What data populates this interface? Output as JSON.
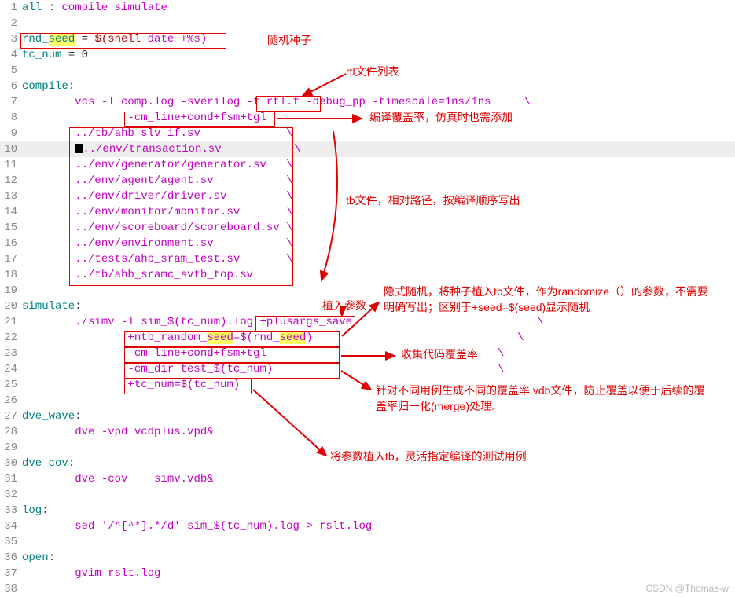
{
  "watermark": "CSDN @Thomas-w",
  "lines": {
    "l1_all": "all",
    "l1_sep": " : ",
    "l1_rest": "compile simulate",
    "l3_rnd": "rnd_",
    "l3_seed": "seed",
    "l3_eq": " = ",
    "l3_shell": "$(shell",
    "l3_date": " date +%s)",
    "l4_tcnum": "tc_num",
    "l4_rest": " = 0",
    "l6_compile": "compile",
    "l6_colon": ":",
    "l7_indent": "        ",
    "l7_vcs": "vcs -l comp.log -sverilog -f rtl.f -debug_pp -timescale=1ns/1ns     \\",
    "l8_indent": "                ",
    "l8_cm": "-cm_line+cond+fsm+tgl",
    "l8_bs": "                       \\",
    "l9_indent": "        ",
    "l9_txt": "../tb/ahb_slv_if.sv",
    "l9_bs": "             \\",
    "l10_indent": "        ",
    "l10_txt": "../env/transaction.sv",
    "l10_bs": "           \\",
    "l11_indent": "        ",
    "l11_txt": "../env/generator/generator.sv",
    "l11_bs": "   \\",
    "l12_indent": "        ",
    "l12_txt": "../env/agent/agent.sv",
    "l12_bs": "           \\",
    "l13_indent": "        ",
    "l13_txt": "../env/driver/driver.sv",
    "l13_bs": "         \\",
    "l14_indent": "        ",
    "l14_txt": "../env/monitor/monitor.sv",
    "l14_bs": "       \\",
    "l15_indent": "        ",
    "l15_txt": "../env/scoreboard/scoreboard.sv",
    "l15_bs": " \\",
    "l16_indent": "        ",
    "l16_txt": "../env/environment.sv",
    "l16_bs": "           \\",
    "l17_indent": "        ",
    "l17_txt": "../tests/ahb_sram_test.sv",
    "l17_bs": "       \\",
    "l18_indent": "        ",
    "l18_txt": "../tb/ahb_sramc_svtb_top.sv",
    "l20_sim": "simulate",
    "l20_colon": ":",
    "l21_indent": "        ",
    "l21_a": "./simv -l sim_$(tc_num).log ",
    "l21_b": "+plusargs_save",
    "l21_bs": "                            \\",
    "l22_indent": "                ",
    "l22_a": "+ntb_random_",
    "l22_seed1": "seed",
    "l22_b": "=$(rnd_",
    "l22_seed2": "seed",
    "l22_c": ")",
    "l22_bs": "                               \\",
    "l23_indent": "                ",
    "l23_txt": "-cm_line+cond+fsm+tgl",
    "l23_bs": "                                   \\",
    "l24_indent": "                ",
    "l24_txt": "-cm_dir test_$(tc_num)",
    "l24_bs": "                                  \\",
    "l25_indent": "                ",
    "l25_txt": "+tc_num=$(tc_num)",
    "l27_dve": "dve_wave",
    "l27_colon": ":",
    "l28_indent": "        ",
    "l28_txt": "dve -vpd vcdplus.vpd&",
    "l30_dve": "dve_cov",
    "l30_colon": ":",
    "l31_indent": "        ",
    "l31_txt": "dve -cov    simv.vdb&",
    "l33_log": "log",
    "l33_colon": ":",
    "l34_indent": "        ",
    "l34_txt": "sed '/^[^*].*/d' sim_$(tc_num).log > rslt.log",
    "l36_open": "open",
    "l36_colon": ":",
    "l37_indent": "        ",
    "l37_txt": "gvim rslt.log"
  },
  "annotations": {
    "a1": "随机种子",
    "a2": "rtl文件列表",
    "a3": "编译覆盖率，仿真时也需添加",
    "a4": "tb文件，相对路径，按编译顺序写出",
    "a5": "植入参数",
    "a6": "隐式随机，将种子植入tb文件，作为randomize（）的参数，不需要明确写出；区别于+seed=$(seed)显示随机",
    "a7": "收集代码覆盖率",
    "a8": "针对不同用例生成不同的覆盖率.vdb文件，防止覆盖以便于后续的覆盖率归一化(merge)处理.",
    "a9": "将参数植入tb，灵活指定编译的测试用例"
  }
}
